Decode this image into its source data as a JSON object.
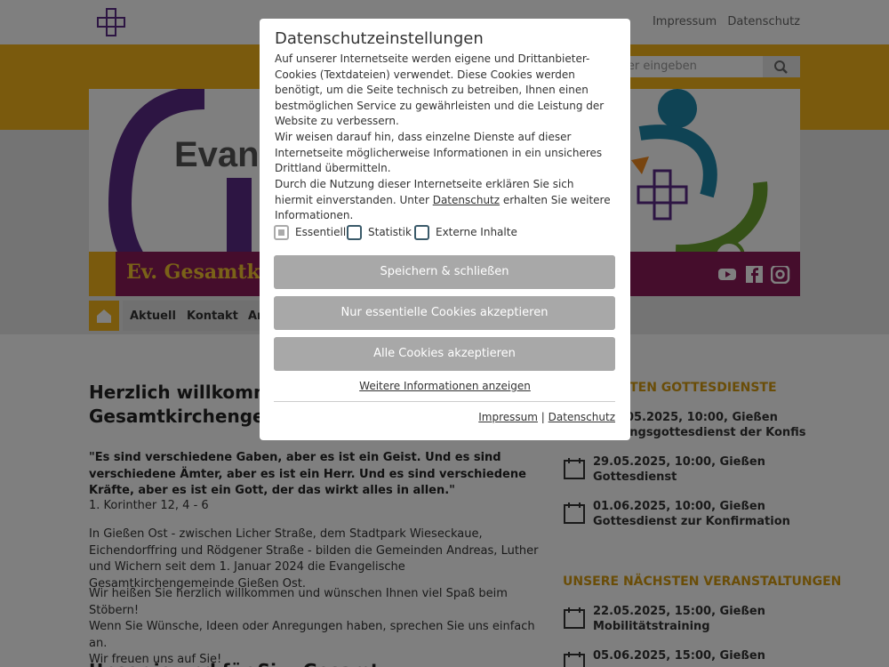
{
  "header": {
    "links": [
      "Impressum",
      "Datenschutz"
    ],
    "search_placeholder": "hier eingeben"
  },
  "banner": {
    "title": "Ev. Gesamtki",
    "evang_text": "Evang"
  },
  "nav": {
    "items": [
      "Aktuell",
      "Kontakt",
      "An"
    ]
  },
  "main": {
    "heading_line1": "Herzlich willkomm",
    "heading_line2": "Gesamtkirchengem",
    "quote": "\"Es sind verschiedene Gaben, aber es ist ein Geist. Und es sind verschiedene Ämter, aber es ist ein Herr. Und es sind verschiedene Kräfte, aber es ist ein Gott, der das wirkt alles in allen.\"",
    "quote_ref": "1. Korinther 12, 4 - 6",
    "para1": "In Gießen Ost - zwischen Licher Straße, dem Stadtpark Wieseckaue, Eichendorffring und Rödgener Straße - bilden die Gemeinden Andreas, Luther und Wichern seit dem 1. Januar 2024 die Evangelische Gesamtkirchengemeinde Gießen Ost.",
    "para2_line1": "Wir heißen Sie herzlich willkommen und wünschen Ihnen viel Spaß beim Stöbern!",
    "para2_line2": "Wenn Sie Wünsche, Ideen oder Anregungen haben, sprechen Sie uns einfach an.",
    "para2_line3": "Wir freuen uns auf Sie!",
    "heading2": "Unser ie und für Si... Gesamt"
  },
  "sidebar": {
    "services_head": "CHSTEN GOTTESDIENSTE",
    "services": [
      {
        "line1": ".05.2025, 10:00, Gießen",
        "line2": "ungsgottesdienst der Konfis"
      },
      {
        "line1": "29.05.2025, 10:00, Gießen",
        "line2": "Gottesdienst"
      },
      {
        "line1": "01.06.2025, 10:00, Gießen",
        "line2": "Gottesdienst zur Konfirmation"
      }
    ],
    "events_head": "UNSERE NÄCHSTEN VERANSTALTUNGEN",
    "events": [
      {
        "line1": "22.05.2025, 15:00, Gießen",
        "line2": "Mobilitätstraining"
      },
      {
        "line1": "05.06.2025, 15:00, Gießen",
        "line2": ""
      }
    ]
  },
  "modal": {
    "title": "Datenschutzeinstellungen",
    "text1": "Auf unserer Internetseite werden eigene und Drittanbieter-Cookies (Textdateien) verwendet. Diese Cookies werden benötigt, um die Seite technisch zu betreiben, Ihnen einen bestmöglichen Service zu gewährleisten und die Leistung der Website zu verbessern.",
    "text2": "Wir weisen darauf hin, dass einzelne Dienste auf dieser Internetseite möglicherweise Informationen in ein unsicheres Drittland übermitteln.",
    "text3_a": "Durch die Nutzung dieser Internetseite erklären Sie sich hiermit einverstanden. Unter ",
    "text3_link": "Datenschutz",
    "text3_b": " erhalten Sie weitere Informationen.",
    "checkboxes": [
      {
        "label": "Essentiell",
        "checked": true
      },
      {
        "label": "Statistik",
        "checked": false
      },
      {
        "label": "Externe Inhalte",
        "checked": false
      }
    ],
    "btn_save": "Speichern & schließen",
    "btn_essential": "Nur essentielle Cookies akzeptieren",
    "btn_all": "Alle Cookies akzeptieren",
    "more_info": "Weitere Informationen anzeigen",
    "footer_impressum": "Impressum",
    "footer_sep": " | ",
    "footer_datenschutz": "Datenschutz"
  },
  "colors": {
    "yellow": "#f5b41a",
    "purple": "#5b2a86",
    "magenta": "#8b1a58",
    "button_gray": "#a8a8a8"
  }
}
